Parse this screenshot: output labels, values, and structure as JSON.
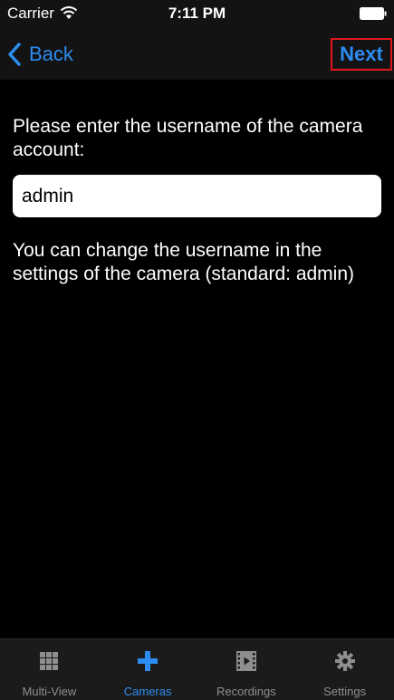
{
  "status_bar": {
    "carrier": "Carrier",
    "time": "7:11 PM"
  },
  "nav": {
    "back_label": "Back",
    "next_label": "Next"
  },
  "form": {
    "prompt": "Please enter the username of the camera account:",
    "username_value": "admin",
    "hint": "You can change the username in the settings of the camera (standard: admin)"
  },
  "tabs": [
    {
      "label": "Multi-View",
      "icon": "grid-icon"
    },
    {
      "label": "Cameras",
      "icon": "plus-icon",
      "active": true
    },
    {
      "label": "Recordings",
      "icon": "film-icon"
    },
    {
      "label": "Settings",
      "icon": "gear-icon"
    }
  ],
  "colors": {
    "accent": "#2d8cf0",
    "highlight_border": "#e0161c",
    "background": "#000000",
    "bar_background": "#131313",
    "tab_inactive": "#8e8e8e"
  }
}
